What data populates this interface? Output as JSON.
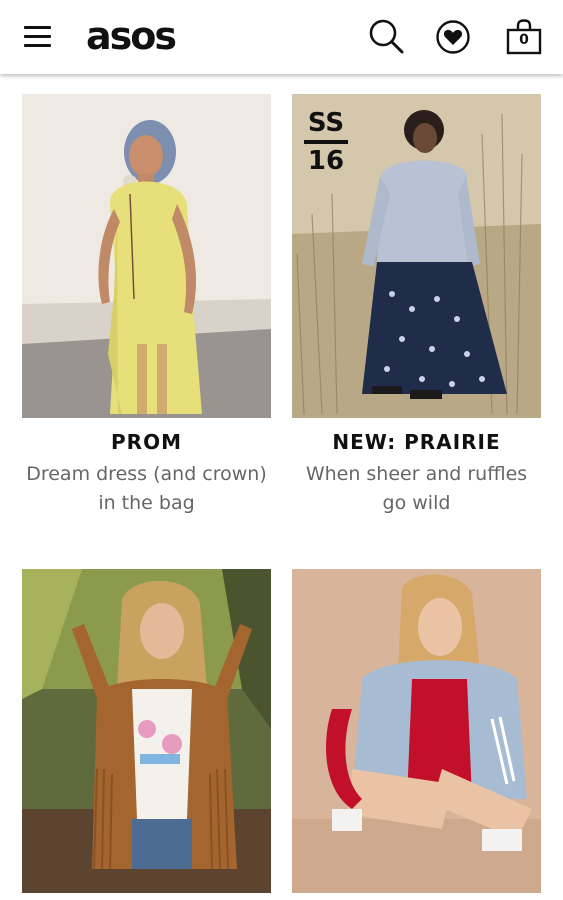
{
  "header": {
    "logo": "asos",
    "menu_icon": "hamburger-menu-icon",
    "search_icon": "search-icon",
    "saved_icon": "heart-icon",
    "bag_icon": "shopping-bag-icon",
    "bag_count": "0"
  },
  "cards": [
    {
      "title": "PROM",
      "subtitle": "Dream dress (and crown) in the bag"
    },
    {
      "title": "NEW: PRAIRIE",
      "subtitle": "When sheer and ruffles go wild",
      "badge_top": "SS",
      "badge_bottom": "16"
    },
    {
      "title": "",
      "subtitle": ""
    },
    {
      "title": "",
      "subtitle": ""
    }
  ],
  "colors": {
    "brand": "#111111",
    "subtitle_text": "#666666",
    "background": "#ffffff"
  }
}
